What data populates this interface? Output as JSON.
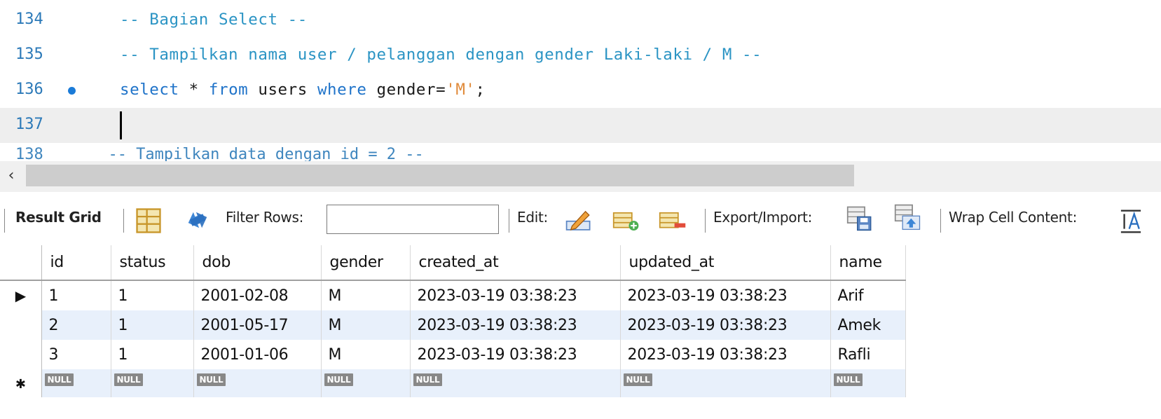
{
  "editor": {
    "lines": [
      {
        "num": "134",
        "tokens": [
          {
            "t": "-- Bagian Select --",
            "c": "comment"
          }
        ]
      },
      {
        "num": "135",
        "tokens": [
          {
            "t": "-- Tampilkan nama user / pelanggan dengan gender Laki-laki / M --",
            "c": "comment"
          }
        ]
      },
      {
        "num": "136",
        "breakpoint": true,
        "tokens": [
          {
            "t": "select",
            "c": "kw"
          },
          {
            "t": " * ",
            "c": "plain"
          },
          {
            "t": "from",
            "c": "kw"
          },
          {
            "t": " users ",
            "c": "plain"
          },
          {
            "t": "where",
            "c": "kw"
          },
          {
            "t": " gender=",
            "c": "plain"
          },
          {
            "t": "'M'",
            "c": "str"
          },
          {
            "t": ";",
            "c": "plain"
          }
        ]
      },
      {
        "num": "137",
        "current": true,
        "tokens": []
      }
    ],
    "partial_text": "138       -- Tampilkan data dengan id = 2 --"
  },
  "toolbar": {
    "result_grid": "Result Grid",
    "filter_rows": "Filter Rows:",
    "filter_value": "",
    "edit": "Edit:",
    "export_import": "Export/Import:",
    "wrap_cell": "Wrap Cell Content:"
  },
  "grid": {
    "columns": [
      "id",
      "status",
      "dob",
      "gender",
      "created_at",
      "updated_at",
      "name"
    ],
    "rows": [
      [
        "1",
        "1",
        "2001-02-08",
        "M",
        "2023-03-19 03:38:23",
        "2023-03-19 03:38:23",
        "Arif"
      ],
      [
        "2",
        "1",
        "2001-05-17",
        "M",
        "2023-03-19 03:38:23",
        "2023-03-19 03:38:23",
        "Amek"
      ],
      [
        "3",
        "1",
        "2001-01-06",
        "M",
        "2023-03-19 03:38:23",
        "2023-03-19 03:38:23",
        "Rafli"
      ]
    ],
    "null_label": "NULL"
  },
  "icons": {
    "grid_view": "grid-view-icon",
    "refresh": "refresh-icon",
    "edit_cell": "edit-pencil-icon",
    "add_row": "add-row-icon",
    "delete_row": "delete-row-icon",
    "export": "export-icon",
    "import": "import-icon",
    "wrap_cell": "wrap-cell-icon"
  }
}
